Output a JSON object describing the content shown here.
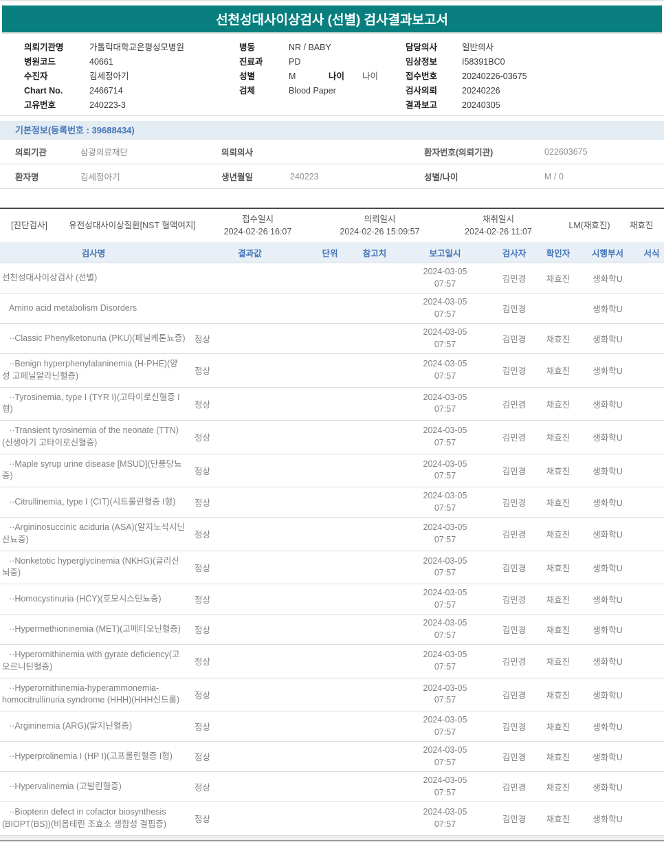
{
  "report": {
    "title": "선천성대사이상검사 (선별) 검사결과보고서"
  },
  "colors": {
    "accent_teal": "#087f7e",
    "section_blue_bg": "#e3ebf3",
    "table_header_bg": "#e9eff6",
    "blue_text": "#4577b8",
    "body_gray": "#808080"
  },
  "header_info": {
    "col1": [
      {
        "label": "의뢰기관명",
        "value": "가톨릭대학교은평성모병원"
      },
      {
        "label": "병원코드",
        "value": "40661"
      },
      {
        "label": "수진자",
        "value": "김세정아기"
      },
      {
        "label": "Chart No.",
        "value": "2466714"
      },
      {
        "label": "고유번호",
        "value": "240223-3"
      }
    ],
    "col2": [
      {
        "label": "병동",
        "value": "NR / BABY"
      },
      {
        "label": "진료과",
        "value": "PD"
      },
      {
        "label": "성별",
        "value": "M",
        "label2": "나이",
        "value2": "나이"
      },
      {
        "label": "검체",
        "value": "Blood Paper"
      }
    ],
    "col3": [
      {
        "label": "담당의사",
        "value": "일반의사"
      },
      {
        "label": "임상정보",
        "value": "I58391BC0"
      },
      {
        "label": "접수번호",
        "value": "20240226-03675"
      },
      {
        "label": "검사의뢰",
        "value": "20240226"
      },
      {
        "label": "결과보고",
        "value": "20240305"
      }
    ]
  },
  "basic_info": {
    "section_title": "기본정보(등록번호 : 39688434)",
    "rows": [
      {
        "c": [
          {
            "label": "의뢰기관",
            "value": "삼광의료재단"
          },
          {
            "label": "의뢰의사",
            "value": ""
          },
          {
            "label": "환자번호(의뢰기관)",
            "value": "022603675"
          }
        ]
      },
      {
        "c": [
          {
            "label": "환자명",
            "value": "김세정아기"
          },
          {
            "label": "생년월일",
            "value": "240223"
          },
          {
            "label": "성별/나이",
            "value": "M / 0"
          }
        ]
      }
    ]
  },
  "order_group": {
    "tag": "[진단검사]",
    "test_group": "유전성대사이상질환[NST 혈액여지]",
    "receipt_label": "접수일시",
    "receipt_time": "2024-02-26 16:07",
    "request_label": "의뢰일시",
    "request_time": "2024-02-26 15:09:57",
    "collect_label": "채취일시",
    "collect_time": "2024-02-26 11:07",
    "lm": "LM(채효진)",
    "collector": "채효진"
  },
  "results_table": {
    "headers": [
      "검사명",
      "결과값",
      "단위",
      "참고치",
      "보고일시",
      "검사자",
      "확인자",
      "시행부서",
      "서식"
    ],
    "rows": [
      {
        "name": "선천성대사이상검사 (선별)",
        "result": "",
        "date": "2024-03-05",
        "time": "07:57",
        "tester": "김민경",
        "confirmer": "채효진",
        "dept": "생화학U",
        "indent": 0
      },
      {
        "name": "Amino acid metabolism Disorders",
        "result": "",
        "date": "2024-03-05",
        "time": "07:57",
        "tester": "김민경",
        "confirmer": "",
        "dept": "생화학U",
        "indent": 1
      },
      {
        "name": "··Classic Phenylketonuria (PKU)(페닐케톤뇨증)",
        "result": "정상",
        "date": "2024-03-05",
        "time": "07:57",
        "tester": "김민경",
        "confirmer": "채효진",
        "dept": "생화학U",
        "indent": 1
      },
      {
        "name": "··Benign hyperphenylalaninemia (H-PHE)(양성 고페닐알라닌혈증)",
        "result": "정상",
        "date": "2024-03-05",
        "time": "07:57",
        "tester": "김민경",
        "confirmer": "채효진",
        "dept": "생화학U",
        "indent": 1
      },
      {
        "name": "··Tyrosinemia, type I (TYR I)(고타이로신혈증 I형)",
        "result": "정상",
        "date": "2024-03-05",
        "time": "07:57",
        "tester": "김민경",
        "confirmer": "채효진",
        "dept": "생화학U",
        "indent": 1
      },
      {
        "name": "··Transient tyrosinemia of the neonate (TTN)(신생아기 고타이로신혈증)",
        "result": "정상",
        "date": "2024-03-05",
        "time": "07:57",
        "tester": "김민경",
        "confirmer": "채효진",
        "dept": "생화학U",
        "indent": 1
      },
      {
        "name": "··Maple syrup urine disease [MSUD](단풍당뇨증)",
        "result": "정상",
        "date": "2024-03-05",
        "time": "07:57",
        "tester": "김민경",
        "confirmer": "채효진",
        "dept": "생화학U",
        "indent": 1
      },
      {
        "name": "··Citrullinemia, type I (CIT)(시트룰린혈증 I형)",
        "result": "정상",
        "date": "2024-03-05",
        "time": "07:57",
        "tester": "김민경",
        "confirmer": "채효진",
        "dept": "생화학U",
        "indent": 1
      },
      {
        "name": "··Argininosuccinic aciduria (ASA)(알지노석시닌산뇨증)",
        "result": "정상",
        "date": "2024-03-05",
        "time": "07:57",
        "tester": "김민경",
        "confirmer": "채효진",
        "dept": "생화학U",
        "indent": 1
      },
      {
        "name": "··Nonketotic hyperglycinemia (NKHG)(글리신뇌증)",
        "result": "정상",
        "date": "2024-03-05",
        "time": "07:57",
        "tester": "김민경",
        "confirmer": "채효진",
        "dept": "생화학U",
        "indent": 1
      },
      {
        "name": "··Homocystinuria (HCY)(호모시스틴뇨증)",
        "result": "정상",
        "date": "2024-03-05",
        "time": "07:57",
        "tester": "김민경",
        "confirmer": "채효진",
        "dept": "생화학U",
        "indent": 1
      },
      {
        "name": "··Hypermethioninemia (MET)(고메티오닌혈증)",
        "result": "정상",
        "date": "2024-03-05",
        "time": "07:57",
        "tester": "김민경",
        "confirmer": "채효진",
        "dept": "생화학U",
        "indent": 1
      },
      {
        "name": "··Hyperornithinemia with gyrate deficiency(고오르니틴혈증)",
        "result": "정상",
        "date": "2024-03-05",
        "time": "07:57",
        "tester": "김민경",
        "confirmer": "채효진",
        "dept": "생화학U",
        "indent": 1
      },
      {
        "name": "··Hyperornithinemia-hyperammonemia-homocitrullinuria syndrome (HHH)(HHH신드롬)",
        "result": "정상",
        "date": "2024-03-05",
        "time": "07:57",
        "tester": "김민경",
        "confirmer": "채효진",
        "dept": "생화학U",
        "indent": 1
      },
      {
        "name": "··Argininemia (ARG)(알지닌혈증)",
        "result": "정상",
        "date": "2024-03-05",
        "time": "07:57",
        "tester": "김민경",
        "confirmer": "채효진",
        "dept": "생화학U",
        "indent": 1
      },
      {
        "name": "··Hyperprolinemia I (HP I)(고프롤린혈증 I형)",
        "result": "정상",
        "date": "2024-03-05",
        "time": "07:57",
        "tester": "김민경",
        "confirmer": "채효진",
        "dept": "생화학U",
        "indent": 1
      },
      {
        "name": "··Hypervalinemia (고발린혈증)",
        "result": "정상",
        "date": "2024-03-05",
        "time": "07:57",
        "tester": "김민경",
        "confirmer": "채효진",
        "dept": "생화학U",
        "indent": 1
      },
      {
        "name": "··Biopterin defect in cofactor biosynthesis (BIOPT(BS))(비옵테린 조효소 생합성 결핍증)",
        "result": "정상",
        "date": "2024-03-05",
        "time": "07:57",
        "tester": "김민경",
        "confirmer": "채효진",
        "dept": "생화학U",
        "indent": 1
      }
    ]
  }
}
